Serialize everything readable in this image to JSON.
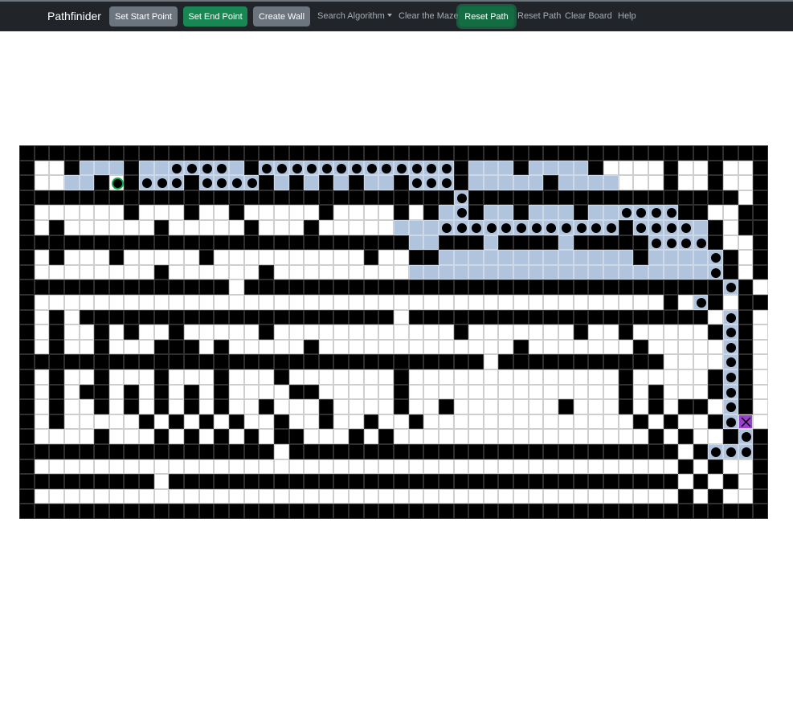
{
  "navbar": {
    "brand": "Pathfinider",
    "set_start": "Set Start Point",
    "set_end": "Set End Point",
    "create_wall": "Create Wall",
    "search_algorithm": "Search Algorithm",
    "clear_maze": "Clear the Maze",
    "reset_path_active": "Reset Path",
    "reset_path": "Reset Path",
    "clear_board": "Clear Board",
    "help": "Help"
  },
  "colors": {
    "navbar": "#212529",
    "wall": "#000000",
    "empty": "#ffffff",
    "visited": "#b0c4de",
    "path_marker": "#000000",
    "start_ring": "#19a34a",
    "end": "#9b3fd1",
    "button_grey": "#6c757d",
    "button_green": "#198754"
  },
  "maze": {
    "columns": 50,
    "rows": 25,
    "legend": {
      "#": "wall",
      ".": "empty",
      "v": "visited",
      "o": "path",
      "S": "start",
      "E": "end"
    },
    "grid": [
      "##################################################",
      "#..#vvv#vvoooov#ooooooooooooo#vvv#vvvv#....#..#..#",
      "#..vv#S#ooo#oooo#v#v#v#vv#ooo#vvvvv#vvvv...#..#..#",
      "#############################o##################.#",
      "#......#...#..#.....#....#.#vo#vv#vvv#vvoooo##..#",
      "#.#......#.....#...#.....vvvoooooooooooo#oooov#.##",
      "##########################vv###v####v#####oooo#..#",
      "#.#...#.....#..........#..##vvvvvvvvvvvvv#vvvvo#.#",
      "#........#......#.........vvvvvvvvvvvvvvvvvvvvo#.#",
      "##############.################################o#.",
      "#..........................................#.o#.#",
      "#.#.#####################.####################.o#.",
      "#.#..#.#..#.....#............#.......#..#.....#o#.",
      "#.#..#...###.#.....#.............#.......#.....o#.",
      "###############################.###########....o#.",
      "#.#..#...#...#...#.......#..............#.....#o#.",
      "#.#.##.#.#.#.#....##.....#..............#.#...#o#.",
      "#.#..#.#.#.#.#..#...#....#..#.......#...#.#.##.o#.",
      "#.#.....#.#.#.#..#..#..#..#..............#.#..#oE..",
      "#....#...#.#.#.#.##...#.#.................#.#..#o#o..",
      "#################.##########################.#ooo#",
      "#...........................................#.#..#",
      "#########.##################################.#.#.#",
      "#...........................................#.#..#",
      "##################################################"
    ]
  }
}
